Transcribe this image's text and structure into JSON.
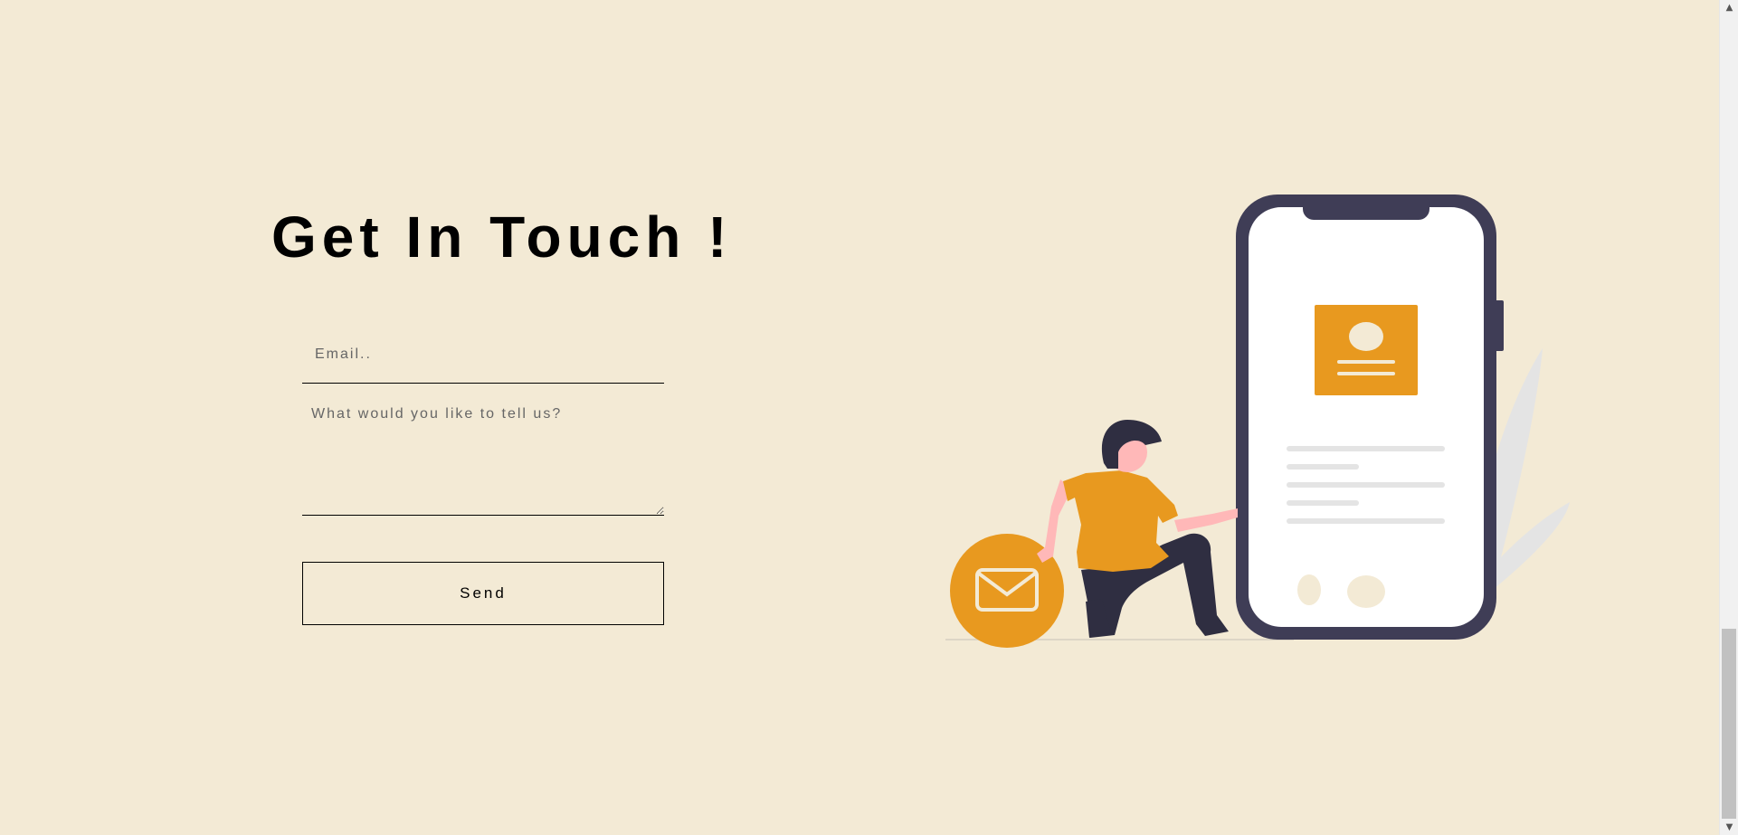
{
  "contact": {
    "title": "Get In Touch !",
    "email_placeholder": "Email..",
    "message_placeholder": "What would you like to tell us?",
    "send_label": "Send"
  },
  "scrollbar": {
    "up_icon": "chevron-up-icon",
    "down_icon": "chevron-down-icon"
  },
  "illustration": {
    "subject": "woman-kneeling-beside-phone-with-mail-icon",
    "accent_color": "#e8991f",
    "phone_color": "#3f3d56",
    "background_color": "#f3ead5"
  }
}
